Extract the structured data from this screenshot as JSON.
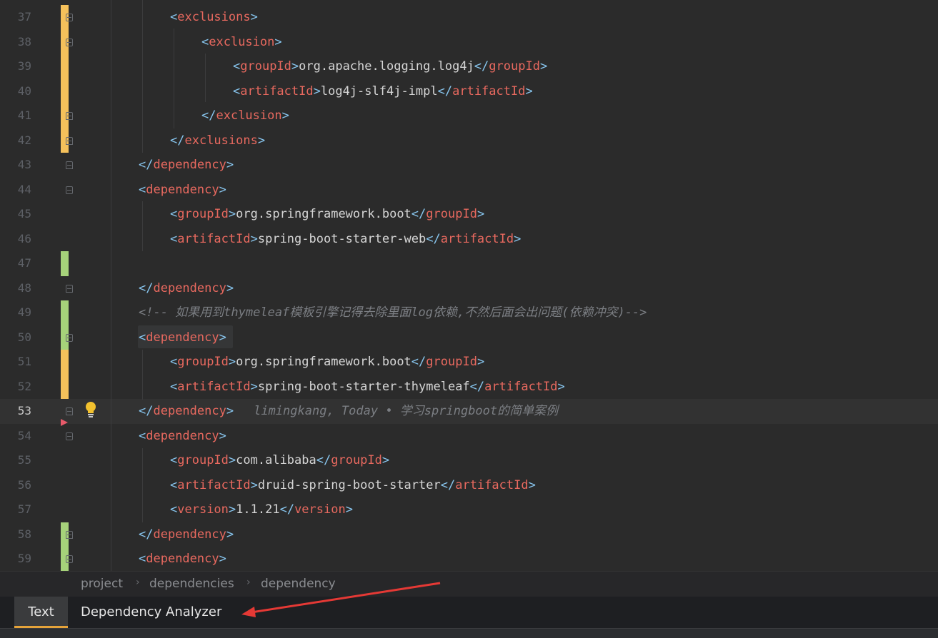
{
  "editor": {
    "lines": [
      {
        "n": "37",
        "ind": 2,
        "seg": [
          [
            "br",
            "<"
          ],
          [
            "tn",
            "exclusions"
          ],
          [
            "br",
            ">"
          ]
        ]
      },
      {
        "n": "38",
        "ind": 3,
        "seg": [
          [
            "br",
            "<"
          ],
          [
            "tn",
            "exclusion"
          ],
          [
            "br",
            ">"
          ]
        ]
      },
      {
        "n": "39",
        "ind": 4,
        "seg": [
          [
            "br",
            "<"
          ],
          [
            "tn",
            "groupId"
          ],
          [
            "br",
            ">"
          ],
          [
            "tx",
            "org.apache.logging.log4j"
          ],
          [
            "br",
            "</"
          ],
          [
            "tn",
            "groupId"
          ],
          [
            "br",
            ">"
          ]
        ]
      },
      {
        "n": "40",
        "ind": 4,
        "seg": [
          [
            "br",
            "<"
          ],
          [
            "tn",
            "artifactId"
          ],
          [
            "br",
            ">"
          ],
          [
            "tx",
            "log4j-slf4j-impl"
          ],
          [
            "br",
            "</"
          ],
          [
            "tn",
            "artifactId"
          ],
          [
            "br",
            ">"
          ]
        ]
      },
      {
        "n": "41",
        "ind": 3,
        "seg": [
          [
            "br",
            "</"
          ],
          [
            "tn",
            "exclusion"
          ],
          [
            "br",
            ">"
          ]
        ]
      },
      {
        "n": "42",
        "ind": 2,
        "seg": [
          [
            "br",
            "</"
          ],
          [
            "tn",
            "exclusions"
          ],
          [
            "br",
            ">"
          ]
        ]
      },
      {
        "n": "43",
        "ind": 1,
        "seg": [
          [
            "br",
            "</"
          ],
          [
            "tn",
            "dependency"
          ],
          [
            "br",
            ">"
          ]
        ]
      },
      {
        "n": "44",
        "ind": 1,
        "seg": [
          [
            "br",
            "<"
          ],
          [
            "tn",
            "dependency"
          ],
          [
            "br",
            ">"
          ]
        ]
      },
      {
        "n": "45",
        "ind": 2,
        "seg": [
          [
            "br",
            "<"
          ],
          [
            "tn",
            "groupId"
          ],
          [
            "br",
            ">"
          ],
          [
            "tx",
            "org.springframework.boot"
          ],
          [
            "br",
            "</"
          ],
          [
            "tn",
            "groupId"
          ],
          [
            "br",
            ">"
          ]
        ]
      },
      {
        "n": "46",
        "ind": 2,
        "seg": [
          [
            "br",
            "<"
          ],
          [
            "tn",
            "artifactId"
          ],
          [
            "br",
            ">"
          ],
          [
            "tx",
            "spring-boot-starter-web"
          ],
          [
            "br",
            "</"
          ],
          [
            "tn",
            "artifactId"
          ],
          [
            "br",
            ">"
          ]
        ]
      },
      {
        "n": "47",
        "ind": 0,
        "seg": []
      },
      {
        "n": "48",
        "ind": 1,
        "seg": [
          [
            "br",
            "</"
          ],
          [
            "tn",
            "dependency"
          ],
          [
            "br",
            ">"
          ]
        ]
      },
      {
        "n": "49",
        "ind": 1,
        "seg": [
          [
            "cm",
            "<!-- 如果用到thymeleaf模板引擎记得去除里面log依赖,不然后面会出问题(依赖冲突)-->"
          ]
        ]
      },
      {
        "n": "50",
        "ind": 1,
        "seg": [
          [
            "br",
            "<"
          ],
          [
            "tn",
            "dependency"
          ],
          [
            "br",
            ">"
          ]
        ]
      },
      {
        "n": "51",
        "ind": 2,
        "seg": [
          [
            "br",
            "<"
          ],
          [
            "tn",
            "groupId"
          ],
          [
            "br",
            ">"
          ],
          [
            "tx",
            "org.springframework.boot"
          ],
          [
            "br",
            "</"
          ],
          [
            "tn",
            "groupId"
          ],
          [
            "br",
            ">"
          ]
        ]
      },
      {
        "n": "52",
        "ind": 2,
        "seg": [
          [
            "br",
            "<"
          ],
          [
            "tn",
            "artifactId"
          ],
          [
            "br",
            ">"
          ],
          [
            "tx",
            "spring-boot-starter-thymeleaf"
          ],
          [
            "br",
            "</"
          ],
          [
            "tn",
            "artifactId"
          ],
          [
            "br",
            ">"
          ]
        ]
      },
      {
        "n": "53",
        "ind": 1,
        "seg": [
          [
            "br",
            "</"
          ],
          [
            "tn",
            "dependency"
          ],
          [
            "br",
            ">"
          ]
        ]
      },
      {
        "n": "54",
        "ind": 1,
        "seg": [
          [
            "br",
            "<"
          ],
          [
            "tn",
            "dependency"
          ],
          [
            "br",
            ">"
          ]
        ]
      },
      {
        "n": "55",
        "ind": 2,
        "seg": [
          [
            "br",
            "<"
          ],
          [
            "tn",
            "groupId"
          ],
          [
            "br",
            ">"
          ],
          [
            "tx",
            "com.alibaba"
          ],
          [
            "br",
            "</"
          ],
          [
            "tn",
            "groupId"
          ],
          [
            "br",
            ">"
          ]
        ]
      },
      {
        "n": "56",
        "ind": 2,
        "seg": [
          [
            "br",
            "<"
          ],
          [
            "tn",
            "artifactId"
          ],
          [
            "br",
            ">"
          ],
          [
            "tx",
            "druid-spring-boot-starter"
          ],
          [
            "br",
            "</"
          ],
          [
            "tn",
            "artifactId"
          ],
          [
            "br",
            ">"
          ]
        ]
      },
      {
        "n": "57",
        "ind": 2,
        "seg": [
          [
            "br",
            "<"
          ],
          [
            "tn",
            "version"
          ],
          [
            "br",
            ">"
          ],
          [
            "tx",
            "1.1.21"
          ],
          [
            "br",
            "</"
          ],
          [
            "tn",
            "version"
          ],
          [
            "br",
            ">"
          ]
        ]
      },
      {
        "n": "58",
        "ind": 1,
        "seg": [
          [
            "br",
            "</"
          ],
          [
            "tn",
            "dependency"
          ],
          [
            "br",
            ">"
          ]
        ]
      },
      {
        "n": "59",
        "ind": 1,
        "seg": [
          [
            "br",
            "<"
          ],
          [
            "tn",
            "dependency"
          ],
          [
            "br",
            ">"
          ]
        ]
      }
    ],
    "current_line": "53",
    "blame": "limingkang, Today • 学习springboot的简单案例",
    "colors": {
      "tag": "#e8695f",
      "bracket": "#88c6ef",
      "text": "#d6d6d6",
      "comment": "#7b7e83",
      "vcs_modified": "#f5c15b",
      "vcs_added": "#a6d27a"
    }
  },
  "breadcrumbs": [
    "project",
    "dependencies",
    "dependency"
  ],
  "tabs": [
    {
      "label": "Text",
      "active": true
    },
    {
      "label": "Dependency Analyzer",
      "active": false
    }
  ]
}
